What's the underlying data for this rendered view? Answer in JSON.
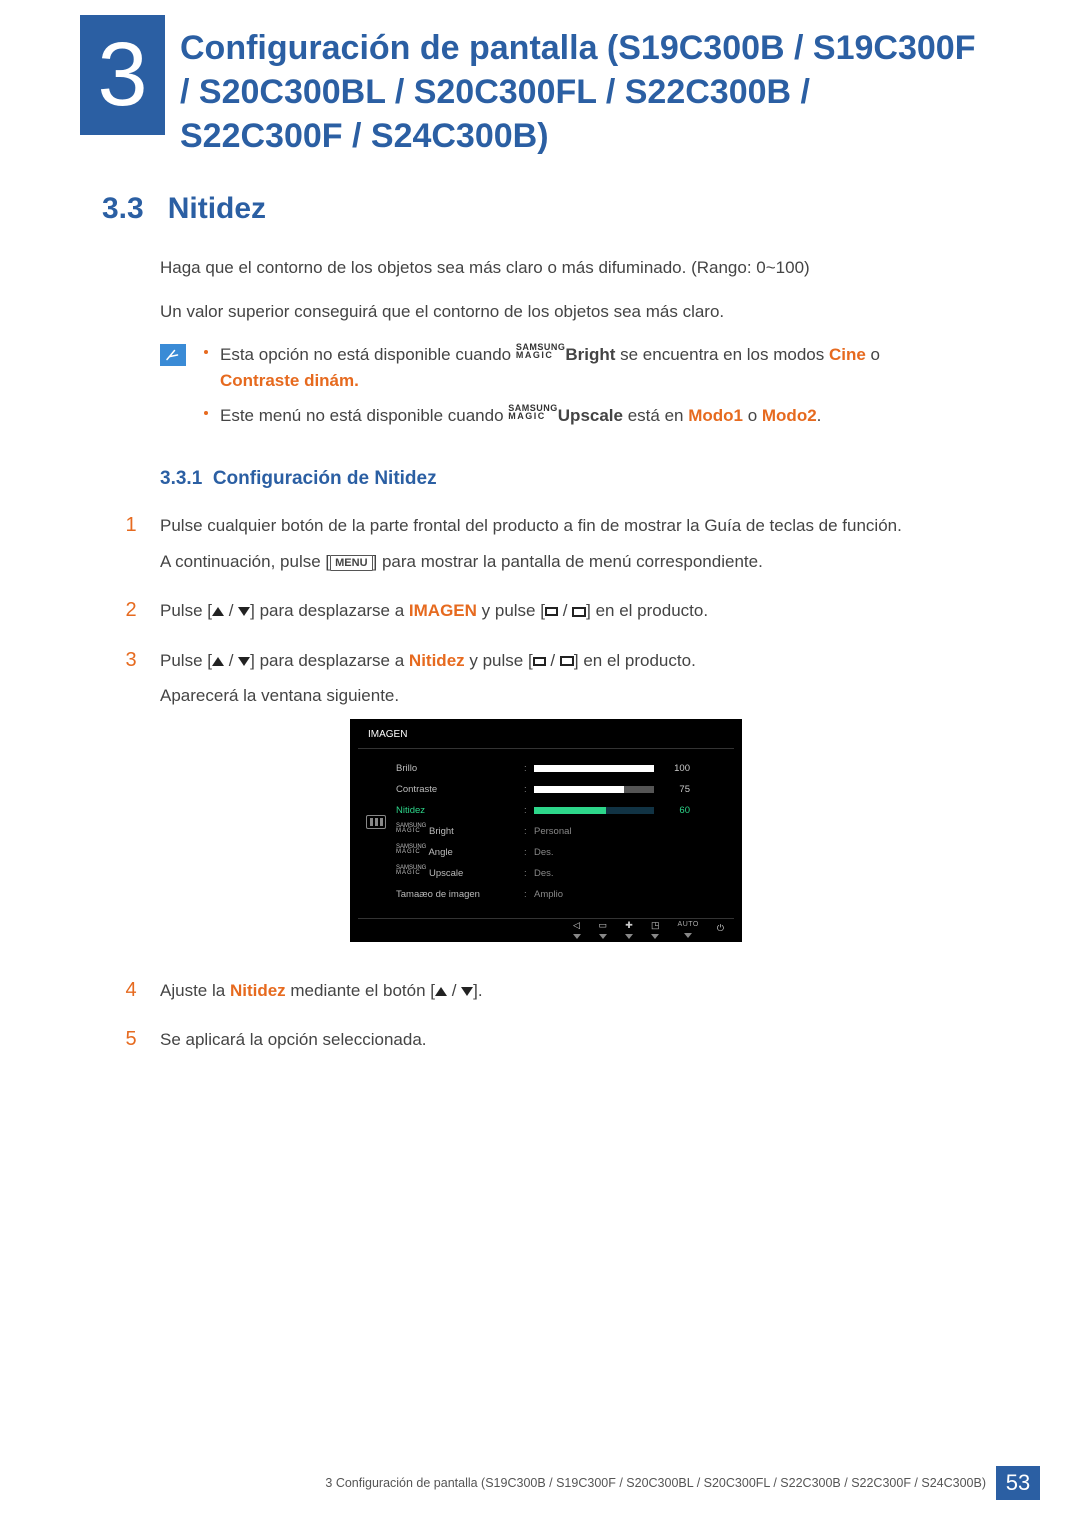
{
  "chapter": {
    "number": "3",
    "title": "Configuración de pantalla (S19C300B / S19C300F / S20C300BL / S20C300FL / S22C300B / S22C300F / S24C300B)"
  },
  "section": {
    "number": "3.3",
    "title": "Nitidez"
  },
  "intro": {
    "p1": "Haga que el contorno de los objetos sea más claro o más difuminado. (Rango: 0~100)",
    "p2": "Un valor superior conseguirá que el contorno de los objetos sea más claro."
  },
  "note": {
    "li1a": "Esta opción no está disponible cuando ",
    "li1_bright": "Bright",
    "li1b": " se encuentra en los modos ",
    "li1_cine": "Cine",
    "li1c": " o ",
    "li1_cont": "Contraste dinám.",
    "li2a": "Este menú no está disponible cuando ",
    "li2_up": "Upscale",
    "li2b": " está en ",
    "li2_m1": "Modo1",
    "li2c": " o ",
    "li2_m2": "Modo2",
    "li2d": "."
  },
  "subsection": {
    "number": "3.3.1",
    "title": "Configuración de Nitidez"
  },
  "steps": {
    "s1a": "Pulse cualquier botón de la parte frontal del producto a fin de mostrar la Guía de teclas de función.",
    "s1b_a": "A continuación, pulse [",
    "s1b_menu": "MENU",
    "s1b_b": "] para mostrar la pantalla de menú correspondiente.",
    "s2a": "Pulse [",
    "s2b": "] para desplazarse a ",
    "s2_imagen": "IMAGEN",
    "s2c": " y pulse [",
    "s2d": "] en el producto.",
    "s3a": "Pulse [",
    "s3b": "] para desplazarse a ",
    "s3_nit": "Nitidez",
    "s3c": " y pulse [",
    "s3d": "] en el producto.",
    "s3e": "Aparecerá la ventana siguiente.",
    "s4a": "Ajuste la ",
    "s4_nit": "Nitidez",
    "s4b": " mediante el botón [",
    "s4c": "].",
    "s5": "Se aplicará la opción seleccionada."
  },
  "osd": {
    "title": "IMAGEN",
    "rows": [
      {
        "label": "Brillo",
        "value": "100",
        "bar": 1.0,
        "type": "bar"
      },
      {
        "label": "Contraste",
        "value": "75",
        "bar": 0.75,
        "type": "bar"
      },
      {
        "label": "Nitidez",
        "value": "60",
        "bar": 0.6,
        "type": "bar",
        "active": true
      },
      {
        "label": "Bright",
        "value": "Personal",
        "type": "text",
        "magic": true
      },
      {
        "label": "Angle",
        "value": "Des.",
        "type": "text",
        "magic": true
      },
      {
        "label": "Upscale",
        "value": "Des.",
        "type": "text",
        "magic": true
      },
      {
        "label": "Tamaæo de imagen",
        "value": "Amplio",
        "type": "text"
      }
    ],
    "foot_auto": "AUTO"
  },
  "magic_label": {
    "top": "SAMSUNG",
    "bottom": "MAGIC"
  },
  "footer": {
    "text": "3 Configuración de pantalla (S19C300B / S19C300F / S20C300BL / S20C300FL / S22C300B / S22C300F / S24C300B)",
    "page": "53"
  }
}
